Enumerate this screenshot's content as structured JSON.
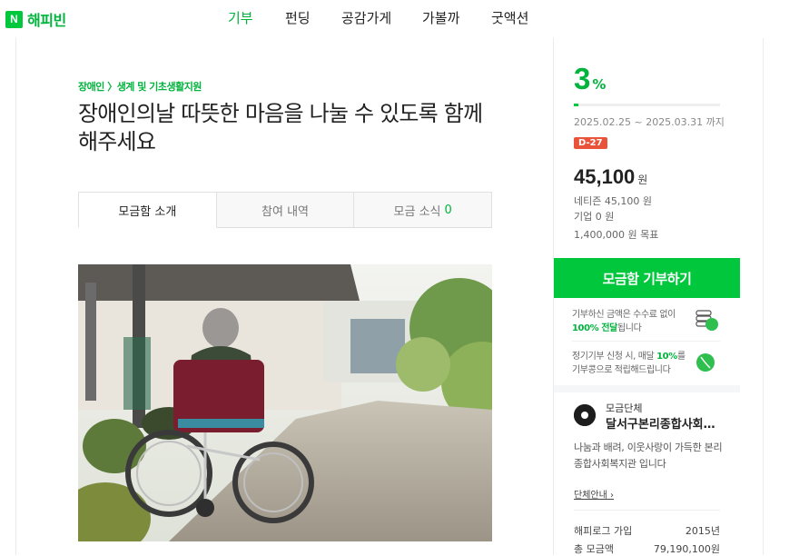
{
  "header": {
    "logo_mark": "N",
    "logo_text": "해피빈",
    "nav": [
      "기부",
      "펀딩",
      "공감가게",
      "가볼까",
      "굿액션"
    ]
  },
  "campaign": {
    "category": "장애인 〉생계 및 기초생활지원",
    "title": "장애인의날 따뜻한 마음을 나눌 수 있도록 함께 해주세요",
    "tabs": [
      {
        "label": "모금함 소개",
        "active": true
      },
      {
        "label": "참여 내역"
      },
      {
        "label": "모금 소식",
        "count": "0"
      }
    ]
  },
  "summary": {
    "percent": "3",
    "percent_unit": "%",
    "progress": 0.032,
    "period": "2025.02.25 ~ 2025.03.31 까지",
    "dday": "D-27",
    "amount": "45,100",
    "amount_unit": "원",
    "netizen": "네티즌 45,100 원",
    "company": "기업 0 원",
    "goal": "1,400,000 원 목표",
    "donate_label": "모금함 기부하기",
    "info1_a": "기부하신 금액은 수수료 없이",
    "info1_b": "100% 전달",
    "info1_c": "됩니다",
    "info2_a": "정기기부 신청 시, 매달 ",
    "info2_b": "10%",
    "info2_c": "를",
    "info2_d": "기부콩으로 적립해드립니다"
  },
  "org": {
    "label": "모금단체",
    "name": "달서구본리종합사회복지관",
    "desc": "나눔과 배려, 이웃사랑이 가득한 본리종합사회복지관 입니다",
    "link": "단체안내 ›",
    "rows": [
      {
        "label": "해피로그 가입",
        "value": "2015년"
      },
      {
        "label": "총 모금액",
        "value": "79,190,100원"
      }
    ]
  },
  "colors": {
    "brand": "#00c73c",
    "dday": "#e8533a"
  }
}
